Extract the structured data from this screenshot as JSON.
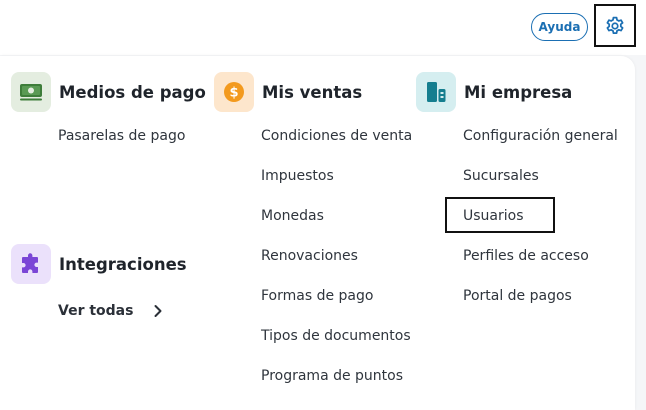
{
  "header": {
    "help_label": "Ayuda",
    "settings_icon": "gear-icon"
  },
  "sections": {
    "payments": {
      "title": "Medios de pago",
      "icon": "money-icon",
      "icon_bg": "#e4ede0",
      "items": [
        "Pasarelas de pago"
      ]
    },
    "sales": {
      "title": "Mis ventas",
      "icon": "dollar-coin-icon",
      "icon_bg": "#fde6cc",
      "items": [
        "Condiciones de venta",
        "Impuestos",
        "Monedas",
        "Renovaciones",
        "Formas de pago",
        "Tipos de documentos",
        "Programa de puntos"
      ]
    },
    "company": {
      "title": "Mi empresa",
      "icon": "buildings-icon",
      "icon_bg": "#d5eef0",
      "items": [
        "Configuración general",
        "Sucursales",
        "Usuarios",
        "Perfiles de acceso",
        "Portal de pagos"
      ]
    },
    "integrations": {
      "title": "Integraciones",
      "icon": "puzzle-icon",
      "icon_bg": "#ebe1fb",
      "see_all_label": "Ver todas"
    }
  },
  "colors": {
    "accent": "#1b6fb3",
    "money_green": "#3e7d3a",
    "coin_orange": "#f39a1e",
    "building_teal": "#157e8f",
    "puzzle_purple": "#7b46d6"
  }
}
